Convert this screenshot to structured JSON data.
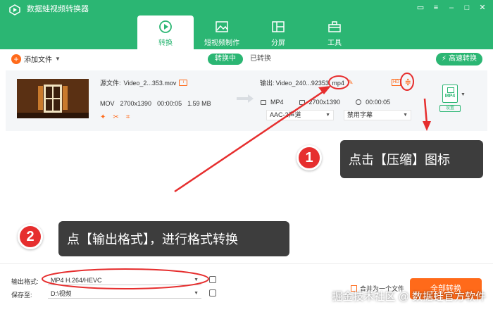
{
  "window": {
    "title": "数据蛙视频转换器",
    "controls": [
      "chat-icon",
      "menu-icon",
      "minimize-icon",
      "maximize-icon",
      "close-icon"
    ]
  },
  "tabs": [
    {
      "label": "转换",
      "icon": "convert-icon",
      "active": true
    },
    {
      "label": "短视频制作",
      "icon": "image-icon",
      "active": false
    },
    {
      "label": "分屏",
      "icon": "split-screen-icon",
      "active": false
    },
    {
      "label": "工具",
      "icon": "toolbox-icon",
      "active": false
    }
  ],
  "toolbar": {
    "add_file": "添加文件",
    "segment": {
      "converting": "转换中",
      "converted": "已转换"
    },
    "fast_convert": "高速转换"
  },
  "file": {
    "source_label": "源文件:",
    "source_name": "Video_2...353.mov",
    "format": "MOV",
    "resolution": "2700x1390",
    "duration": "00:00:05",
    "size": "1.59 MB",
    "output_label": "输出:",
    "output_name": "Video_240...92353.",
    "output_ext": "mp4",
    "out_format": "MP4",
    "out_resolution": "2700x1390",
    "out_duration": "00:00:05",
    "audio": "AAC-2声道",
    "subtitle": "禁用字幕",
    "format_badge": "MP4",
    "format_settings": "设置",
    "hd_badge": "HD"
  },
  "bottom": {
    "output_format_label": "输出格式:",
    "output_format_value": "MP4 H.264/HEVC",
    "save_to_label": "保存至:",
    "save_to_value": "D:\\视频",
    "merge_label": "合并为一个文件",
    "convert_all": "全部转换"
  },
  "annotations": [
    {
      "number": "1",
      "text": "点击【压缩】图标"
    },
    {
      "number": "2",
      "text": "点【输出格式】，进行格式转换"
    }
  ],
  "watermark": "掘金技术社区 @ 数据蛙官方软件",
  "colors": {
    "brand": "#2bb673",
    "accent": "#ff6a1a",
    "annotation_red": "#e62e2e"
  }
}
